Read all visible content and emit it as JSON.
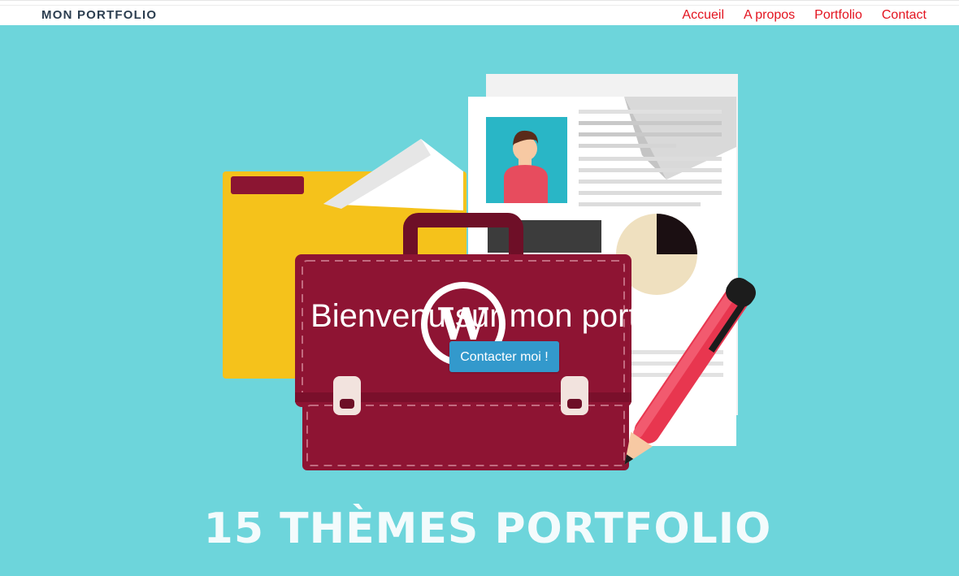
{
  "navbar": {
    "brand": "MON PORTFOLIO",
    "links": [
      "Accueil",
      "A propos",
      "Portfolio",
      "Contact"
    ],
    "link_color": "#e3131f"
  },
  "hero": {
    "title": "Bienvenu sur mon portfolio",
    "cta_label": "Contacter moi !",
    "cta_color": "#3399cc",
    "background_color": "#6dd5db",
    "image_caption": "15 THÈMES PORTFOLIO",
    "image_icons": [
      "folder-icon",
      "briefcase-icon",
      "wordpress-logo-icon",
      "resume-document-icon",
      "pen-icon",
      "pie-chart-icon",
      "avatar-icon"
    ]
  }
}
